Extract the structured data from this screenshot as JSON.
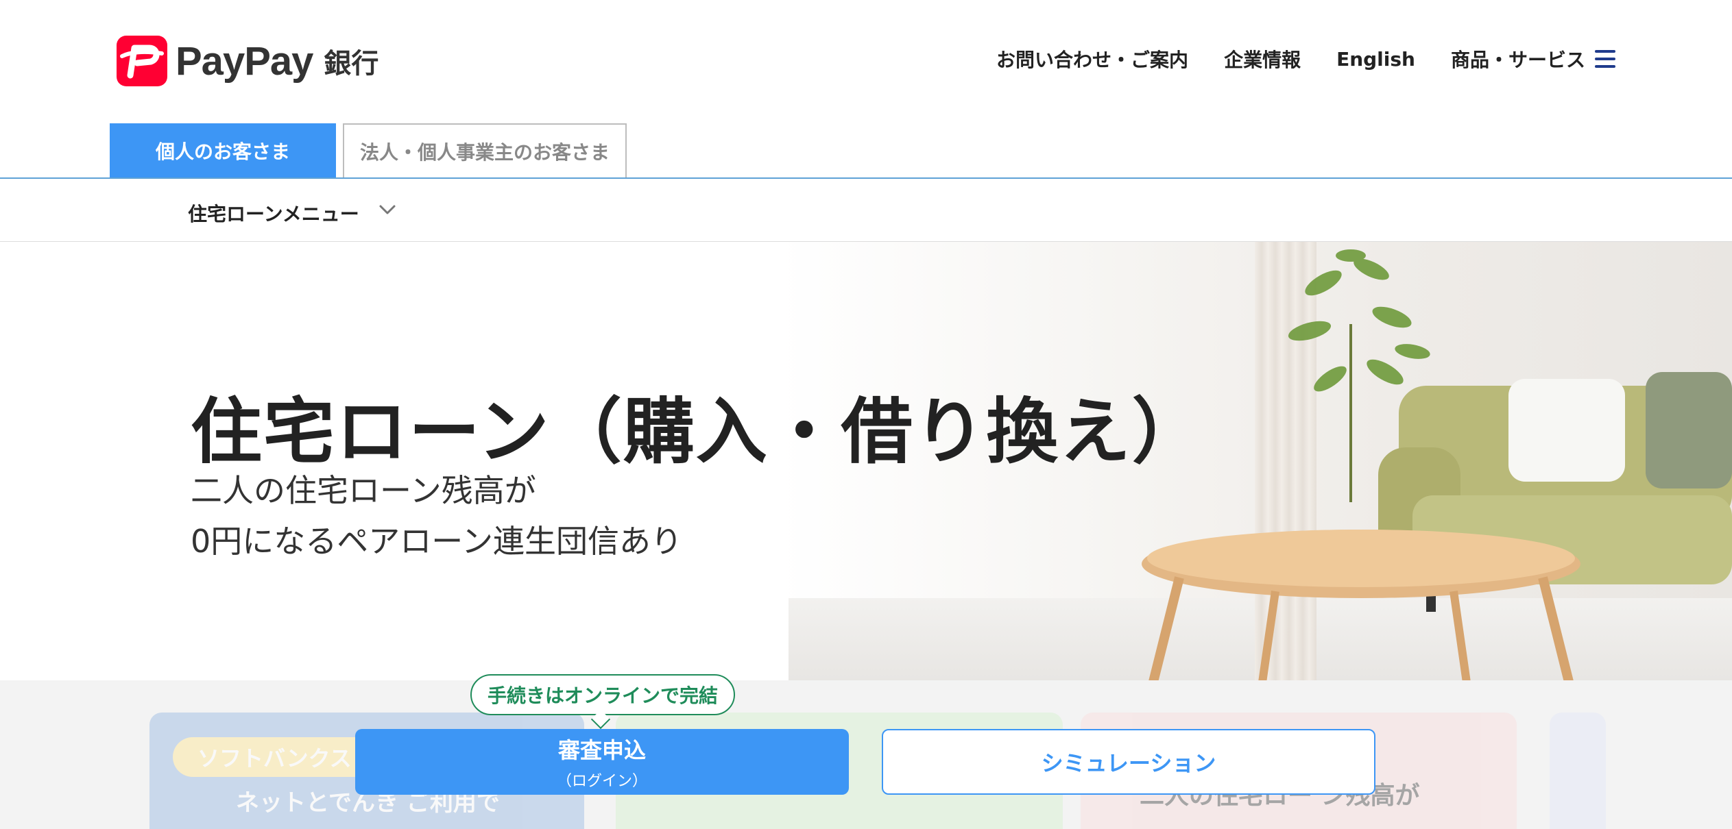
{
  "header": {
    "logo_text": "PayPay",
    "logo_sub": "銀行",
    "nav": [
      {
        "label": "お問い合わせ・ご案内"
      },
      {
        "label": "企業情報"
      },
      {
        "label": "English"
      },
      {
        "label": "商品・サービス"
      }
    ]
  },
  "tabs": {
    "personal": "個人のお客さま",
    "business": "法人・個人事業主のお客さま"
  },
  "submenu": {
    "label": "住宅ローンメニュー"
  },
  "hero": {
    "title": "住宅ローン（購入・借り換え）",
    "subtitle_line1": "二人の住宅ローン残高が",
    "subtitle_line2": "0円になるペアローン連生団信あり"
  },
  "cta": {
    "bubble": "手続きはオンラインで完結",
    "apply_label": "審査申込",
    "apply_sub": "（ログイン）",
    "simulation_label": "シミュレーション"
  },
  "cards": {
    "card1_pill": "ソフトバンクス",
    "card1_text": "ネットとでんき ご利用で",
    "card3_text": "二人の住宅ロー ン残高が"
  },
  "colors": {
    "brand_red": "#ff0033",
    "primary_blue": "#3d96f5",
    "online_green": "#1f8c5a"
  }
}
